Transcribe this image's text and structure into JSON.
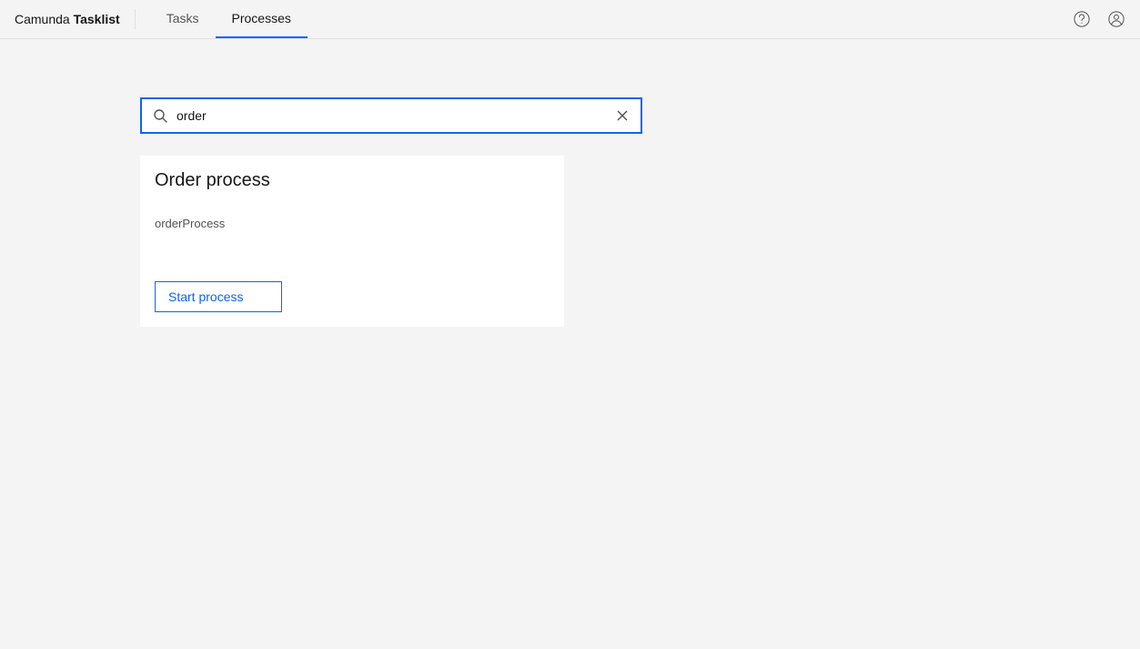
{
  "header": {
    "brand_prefix": "Camunda ",
    "brand_name": "Tasklist",
    "tabs": [
      {
        "label": "Tasks",
        "active": false
      },
      {
        "label": "Processes",
        "active": true
      }
    ]
  },
  "search": {
    "value": "order",
    "placeholder": ""
  },
  "results": [
    {
      "title": "Order process",
      "key": "orderProcess",
      "action_label": "Start process"
    }
  ],
  "colors": {
    "accent": "#0f62fe",
    "background": "#f4f4f4",
    "surface": "#ffffff",
    "border": "#e0e0e0",
    "text_primary": "#161616",
    "text_secondary": "#525252"
  }
}
